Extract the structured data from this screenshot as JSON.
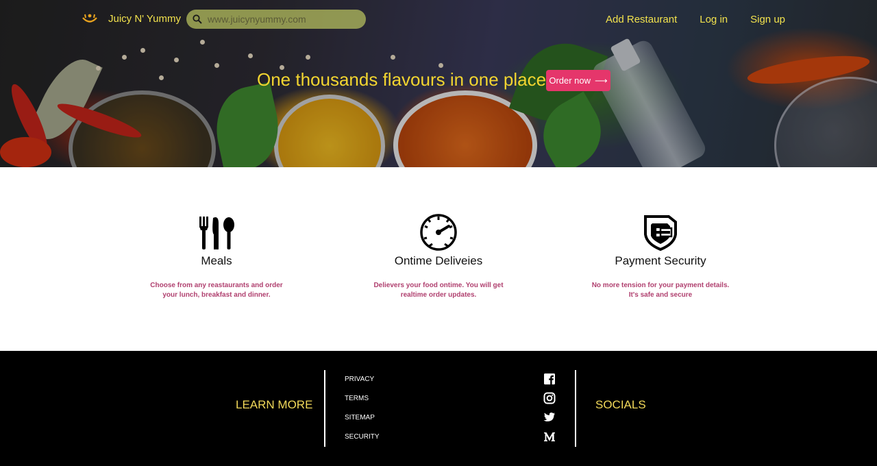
{
  "nav": {
    "brand": "Juicy N' Yummy",
    "search_placeholder": "www.juicynyummy.com",
    "links": [
      "Add Restaurant",
      "Log in",
      "Sign up"
    ]
  },
  "hero": {
    "tagline": "One thousands flavours in one place",
    "cta_label": "Order now",
    "cta_arrow": "⟶"
  },
  "features": [
    {
      "icon": "cutlery-icon",
      "title": "Meals",
      "text": "Choose from any reastaurants and order your lunch, breakfast and dinner."
    },
    {
      "icon": "speedometer-icon",
      "title": "Ontime Deliveies",
      "text": "Delievers your food ontime. You will get realtime order updates."
    },
    {
      "icon": "shield-icon",
      "title": "Payment Security",
      "text": "No more tension for your payment details. It's safe and secure"
    }
  ],
  "footer": {
    "learn_more": "LEARN MORE",
    "links": [
      "PRIVACY",
      "TERMS",
      "SITEMAP",
      "SECURITY"
    ],
    "socials_label": "SOCIALS",
    "social_icons": [
      "facebook-icon",
      "instagram-icon",
      "twitter-icon",
      "medium-icon"
    ]
  },
  "colors": {
    "accent_yellow": "#f2e24d",
    "cta_pink": "#e5366b",
    "feature_text": "#b0406f",
    "footer_bg": "#000000"
  }
}
